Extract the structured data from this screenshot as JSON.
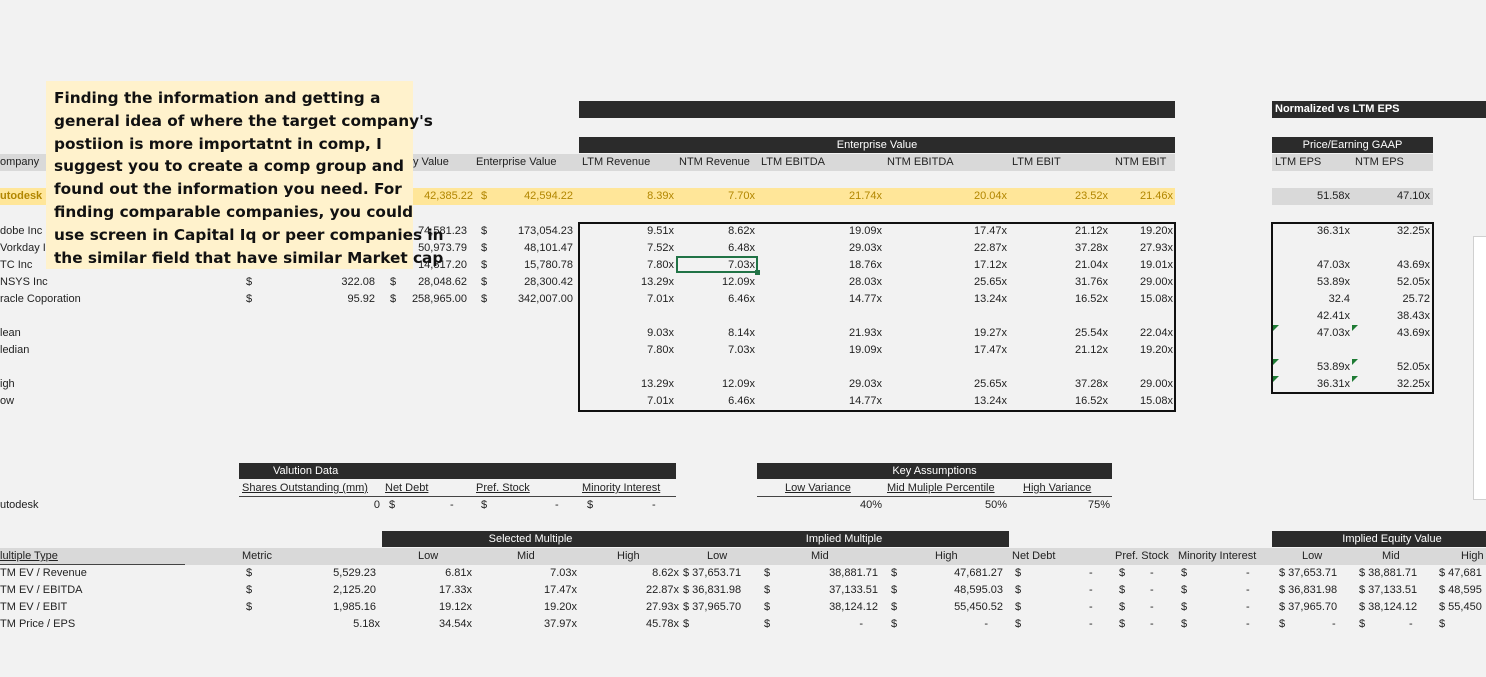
{
  "top": {
    "normalized_title": "Normalized vs LTM EPS",
    "ev_title": "Enterprise Value",
    "pe_title": "Price/Earning GAAP"
  },
  "headers": {
    "company": "ompany",
    "equity_value": "y Value",
    "enterprise_value": "Enterprise Value",
    "ltm_revenue": "LTM Revenue",
    "ntm_revenue": "NTM Revenue",
    "ltm_ebitda": "LTM EBITDA",
    "ntm_ebitda": "NTM EBITDA",
    "ltm_ebit": "LTM EBIT",
    "ntm_ebit": "NTM EBIT",
    "ltm_eps": "LTM EPS",
    "ntm_eps": "NTM EPS"
  },
  "target": {
    "name": "utodesk",
    "equity": "42,385.22",
    "ev_sym": "$",
    "ev": "42,594.22",
    "mults": [
      "8.39x",
      "7.70x",
      "21.74x",
      "20.04x",
      "23.52x",
      "21.46x"
    ],
    "eps": [
      "51.58x",
      "47.10x"
    ]
  },
  "comps": [
    {
      "name": "dobe Inc",
      "price_sym": "",
      "price": "",
      "eq_sym": "",
      "equity": "74,581.23",
      "ev_sym": "$",
      "ev": "173,054.23",
      "mults": [
        "9.51x",
        "8.62x",
        "19.09x",
        "17.47x",
        "21.12x",
        "19.20x"
      ],
      "eps": [
        "36.31x",
        "32.25x"
      ]
    },
    {
      "name": "Vorkday I",
      "price_sym": "",
      "price": "",
      "eq_sym": "",
      "equity": "50,973.79",
      "ev_sym": "$",
      "ev": "48,101.47",
      "mults": [
        "7.52x",
        "6.48x",
        "29.03x",
        "22.87x",
        "37.28x",
        "27.93x"
      ],
      "eps": [
        "",
        ""
      ]
    },
    {
      "name": "TC Inc",
      "price_sym": "",
      "price": "",
      "eq_sym": "",
      "equity": "14,817.20",
      "ev_sym": "$",
      "ev": "15,780.78",
      "mults": [
        "7.80x",
        "7.03x",
        "18.76x",
        "17.12x",
        "21.04x",
        "19.01x"
      ],
      "eps": [
        "47.03x",
        "43.69x"
      ]
    },
    {
      "name": "NSYS Inc",
      "price_sym": "$",
      "price": "322.08",
      "eq_sym": "$",
      "equity": "28,048.62",
      "ev_sym": "$",
      "ev": "28,300.42",
      "mults": [
        "13.29x",
        "12.09x",
        "28.03x",
        "25.65x",
        "31.76x",
        "29.00x"
      ],
      "eps": [
        "53.89x",
        "52.05x"
      ]
    },
    {
      "name": "racle Coporation",
      "price_sym": "$",
      "price": "95.92",
      "eq_sym": "$",
      "equity": "258,965.00",
      "ev_sym": "$",
      "ev": "342,007.00",
      "mults": [
        "7.01x",
        "6.46x",
        "14.77x",
        "13.24x",
        "16.52x",
        "15.08x"
      ],
      "eps": [
        "32.4",
        "25.72"
      ]
    }
  ],
  "stats": {
    "extra_eps": [
      "42.41x",
      "38.43x"
    ],
    "mean": {
      "label": "lean",
      "mults": [
        "9.03x",
        "8.14x",
        "21.93x",
        "19.27x",
        "25.54x",
        "22.04x"
      ],
      "eps": [
        "47.03x",
        "43.69x"
      ]
    },
    "median": {
      "label": "ledian",
      "mults": [
        "7.80x",
        "7.03x",
        "19.09x",
        "17.47x",
        "21.12x",
        "19.20x"
      ]
    },
    "high": {
      "label": "igh",
      "mults": [
        "13.29x",
        "12.09x",
        "29.03x",
        "25.65x",
        "37.28x",
        "29.00x"
      ],
      "eps": [
        "53.89x",
        "52.05x"
      ]
    },
    "low": {
      "label": "ow",
      "mults": [
        "7.01x",
        "6.46x",
        "14.77x",
        "13.24x",
        "16.52x",
        "15.08x"
      ],
      "eps": [
        "36.31x",
        "32.25x"
      ]
    }
  },
  "note": {
    "lines": [
      "Finding the information and getting a",
      "general idea of where the target company's",
      "postiion is more importatnt in comp, I",
      "suggest you to create a comp group and",
      "found out the information you need. For",
      "finding comparable companies, you could",
      "use screen in Capital Iq or peer companies in",
      "the similar field that have similar Market cap"
    ]
  },
  "valuation": {
    "title": "Valution Data",
    "shares_label": "Shares Outstanding (mm)",
    "net_debt_label": "Net Debt",
    "pref_label": "Pref. Stock",
    "minority_label": "Minority Interest",
    "row_name": "utodesk",
    "shares": "0",
    "sym": "$",
    "dash": "-"
  },
  "assumptions": {
    "title": "Key Assumptions",
    "low_label": "Low Variance",
    "mid_label": "Mid Muliple Percentile",
    "high_label": "High Variance",
    "low": "40%",
    "mid": "50%",
    "high": "75%"
  },
  "implied": {
    "selected_title": "Selected Multiple",
    "implied_title": "Implied Multiple",
    "equity_title": "Implied Equity Value",
    "h_type": "lultiple Type",
    "h_metric": "Metric",
    "h_low": "Low",
    "h_mid": "Mid",
    "h_high": "High",
    "h_net_debt": "Net Debt",
    "h_pref": "Pref. Stock",
    "h_minority": "Minority Interest",
    "rows": [
      {
        "type": "TM EV / Revenue",
        "metric_sym": "$",
        "metric": "5,529.23",
        "sel": [
          "6.81x",
          "7.03x",
          "8.62x"
        ],
        "imp": [
          "$ 37,653.71",
          "38,881.71",
          "47,681.27"
        ],
        "eq": [
          "$ 37,653.71",
          "$ 38,881.71",
          "$ 47,681"
        ]
      },
      {
        "type": "TM EV / EBITDA",
        "metric_sym": "$",
        "metric": "2,125.20",
        "sel": [
          "17.33x",
          "17.47x",
          "22.87x"
        ],
        "imp": [
          "$ 36,831.98",
          "37,133.51",
          "48,595.03"
        ],
        "eq": [
          "$ 36,831.98",
          "$ 37,133.51",
          "$ 48,595"
        ]
      },
      {
        "type": "TM EV / EBIT",
        "metric_sym": "$",
        "metric": "1,985.16",
        "sel": [
          "19.12x",
          "19.20x",
          "27.93x"
        ],
        "imp": [
          "$ 37,965.70",
          "38,124.12",
          "55,450.52"
        ],
        "eq": [
          "$ 37,965.70",
          "$ 38,124.12",
          "$ 55,450"
        ]
      },
      {
        "type": "TM Price / EPS",
        "metric_sym": "",
        "metric": "5.18x",
        "sel": [
          "34.54x",
          "37.97x",
          "45.78x"
        ],
        "imp": [
          "$",
          "-",
          "-"
        ],
        "eq": [
          "$",
          "$",
          "$"
        ]
      }
    ]
  }
}
